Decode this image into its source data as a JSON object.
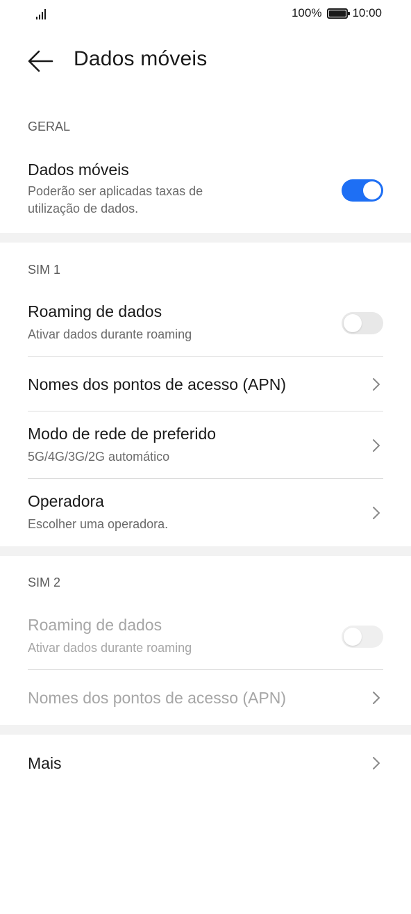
{
  "status": {
    "battery_percent": "100%",
    "time": "10:00"
  },
  "header": {
    "title": "Dados móveis"
  },
  "sections": {
    "general": {
      "header": "GERAL",
      "mobile_data": {
        "title": "Dados móveis",
        "subtitle_line1": "Poderão ser aplicadas taxas de",
        "subtitle_line2": "utilização de dados.",
        "enabled": true
      }
    },
    "sim1": {
      "header": "SIM 1",
      "roaming": {
        "title": "Roaming de dados",
        "subtitle": "Ativar dados durante roaming",
        "enabled": false
      },
      "apn": {
        "title": "Nomes dos pontos de acesso (APN)"
      },
      "network_mode": {
        "title": "Modo de rede de preferido",
        "subtitle": "5G/4G/3G/2G automático"
      },
      "operator": {
        "title": "Operadora",
        "subtitle": "Escolher uma operadora."
      }
    },
    "sim2": {
      "header": "SIM 2",
      "roaming": {
        "title": "Roaming de dados",
        "subtitle": "Ativar dados durante roaming",
        "enabled": false
      },
      "apn": {
        "title": "Nomes dos pontos de acesso (APN)"
      }
    },
    "more": {
      "title": "Mais"
    }
  },
  "colors": {
    "accent": "#1e6ff4",
    "text_primary": "#1a1a1a",
    "text_secondary": "#6a6a6a",
    "text_disabled": "#a6a6a6",
    "section_gap": "#f2f2f2"
  },
  "icons": [
    "signal-icon",
    "battery-icon",
    "back-arrow-icon",
    "chevron-right-icon"
  ]
}
